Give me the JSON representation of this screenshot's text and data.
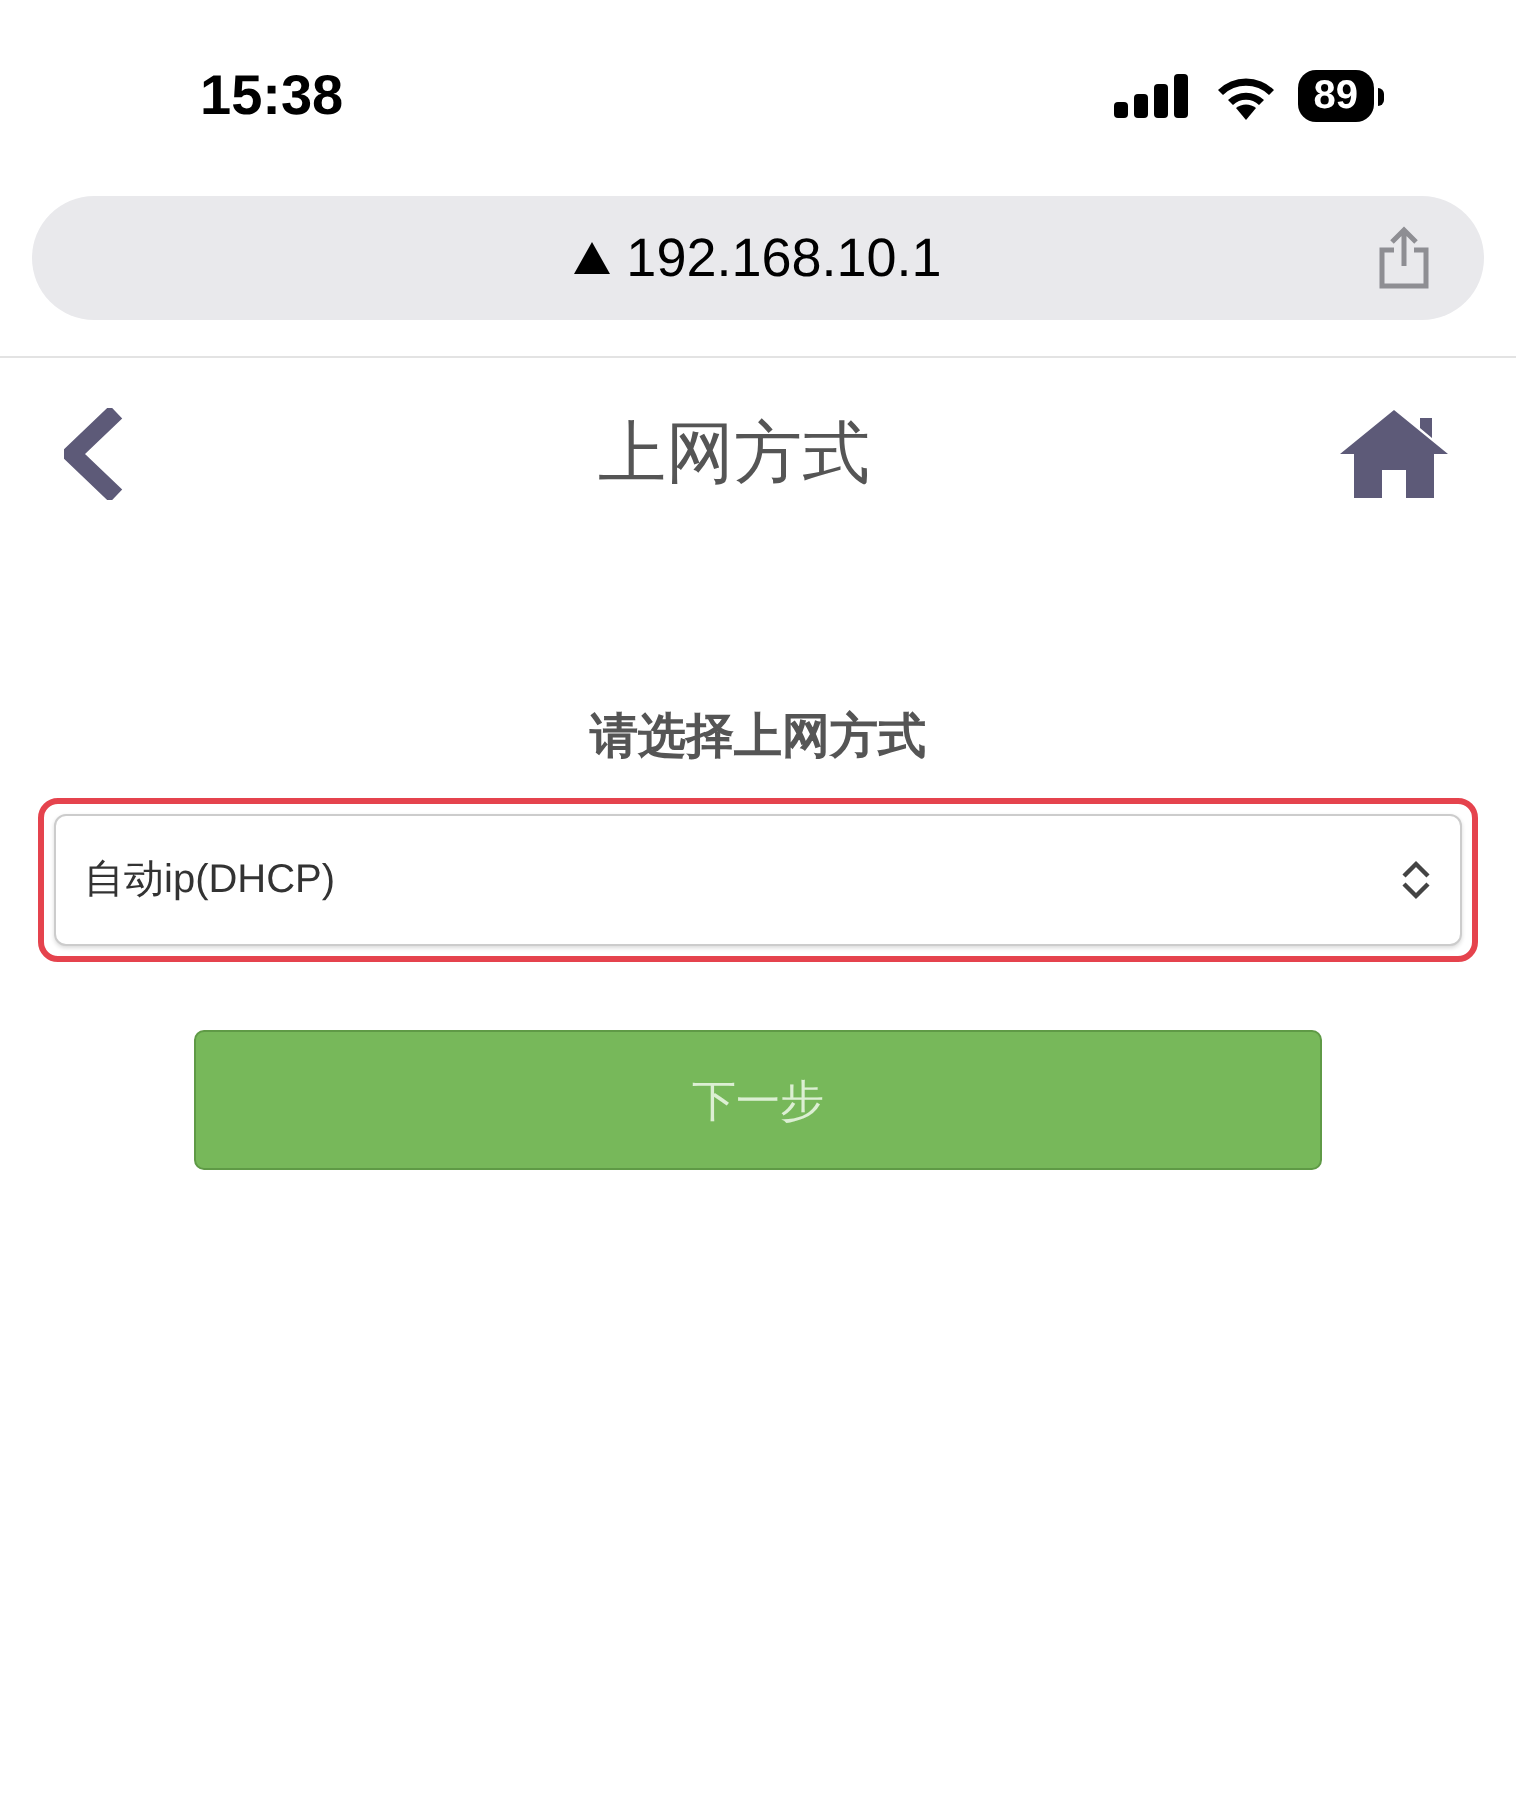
{
  "status_bar": {
    "time": "15:38",
    "battery": "89"
  },
  "address_bar": {
    "url": "192.168.10.1"
  },
  "header": {
    "title": "上网方式"
  },
  "form": {
    "label": "请选择上网方式",
    "select": {
      "value": "自动ip(DHCP)",
      "highlighted": true
    }
  },
  "next_button": {
    "label": "下一步"
  }
}
